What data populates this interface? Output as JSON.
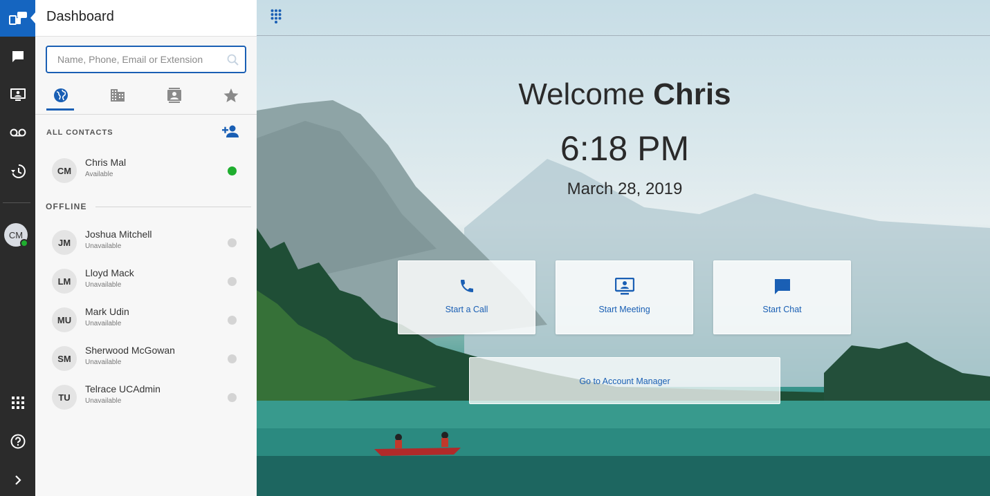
{
  "panel": {
    "title": "Dashboard",
    "search_placeholder": "Name, Phone, Email or Extension",
    "all_contacts_label": "ALL CONTACTS",
    "offline_label": "OFFLINE"
  },
  "rail": {
    "user_initials": "CM"
  },
  "contacts_online": [
    {
      "initials": "CM",
      "name": "Chris Mal",
      "status": "Available"
    }
  ],
  "contacts_offline": [
    {
      "initials": "JM",
      "name": "Joshua Mitchell",
      "status": "Unavailable"
    },
    {
      "initials": "LM",
      "name": "Lloyd Mack",
      "status": "Unavailable"
    },
    {
      "initials": "MU",
      "name": "Mark Udin",
      "status": "Unavailable"
    },
    {
      "initials": "SM",
      "name": "Sherwood McGowan",
      "status": "Unavailable"
    },
    {
      "initials": "TU",
      "name": "Telrace UCAdmin",
      "status": "Unavailable"
    }
  ],
  "main": {
    "welcome_prefix": "Welcome",
    "user_name": "Chris",
    "time": "6:18 PM",
    "date": "March 28, 2019",
    "actions": {
      "call": "Start a Call",
      "meeting": "Start Meeting",
      "chat": "Start Chat"
    },
    "account_manager": "Go to Account Manager"
  },
  "colors": {
    "accent": "#1a5fb4",
    "rail_bg": "#2b2b2b",
    "online": "#1fae2f"
  }
}
